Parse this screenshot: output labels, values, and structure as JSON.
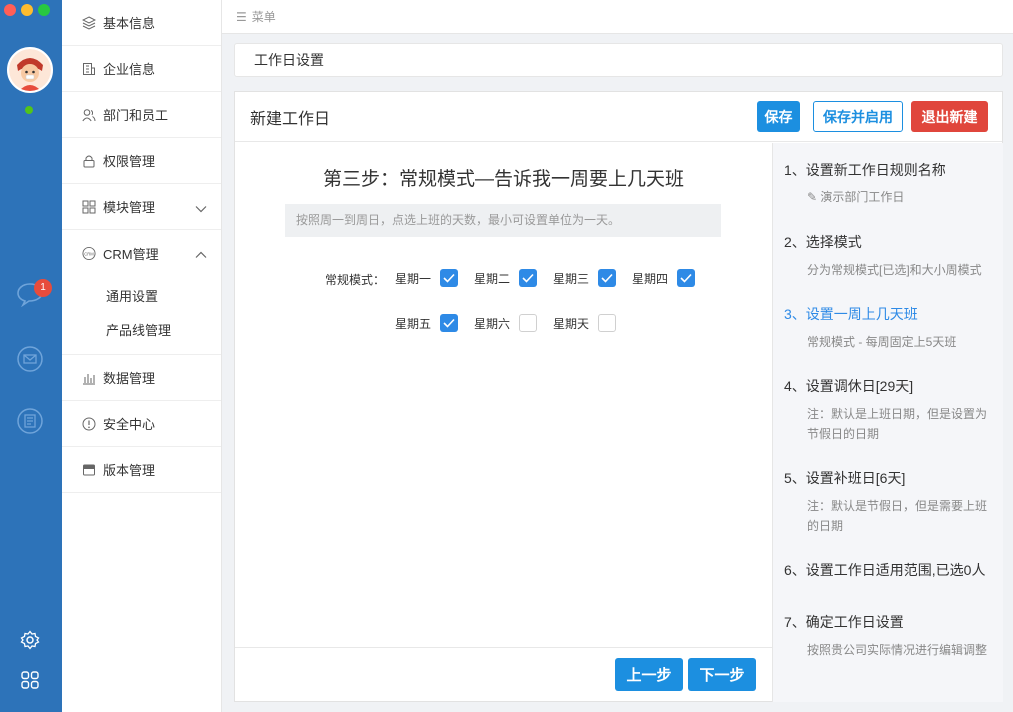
{
  "colors": {
    "rail": "#2d73b9",
    "primary": "#1c8fe0",
    "danger": "#e0463c",
    "checkbox": "#2e8ae6",
    "active_step": "#2e8ae6"
  },
  "window_controls": [
    {
      "name": "close",
      "color": "#ff5f57"
    },
    {
      "name": "minimize",
      "color": "#febc2e"
    },
    {
      "name": "zoom",
      "color": "#28c840"
    }
  ],
  "rail": {
    "message_badge": "1",
    "icons": [
      "chat-icon",
      "mail-icon",
      "notes-icon",
      "settings-icon",
      "apps-icon"
    ]
  },
  "menu": {
    "items": [
      {
        "label": "基本信息",
        "icon": "layers-icon"
      },
      {
        "label": "企业信息",
        "icon": "building-icon"
      },
      {
        "label": "部门和员工",
        "icon": "users-icon"
      },
      {
        "label": "权限管理",
        "icon": "lock-icon"
      },
      {
        "label": "模块管理",
        "icon": "grid-icon",
        "chevron": "down"
      },
      {
        "label": "CRM管理",
        "icon": "crm-icon",
        "chevron": "up"
      },
      {
        "label": "数据管理",
        "icon": "bar-chart-icon"
      },
      {
        "label": "安全中心",
        "icon": "alert-circle-icon"
      },
      {
        "label": "版本管理",
        "icon": "version-icon"
      }
    ],
    "crm_sub": [
      "通用设置",
      "产品线管理"
    ]
  },
  "topbar": {
    "menu_label": "菜单"
  },
  "page_title": "工作日设置",
  "card": {
    "title": "新建工作日",
    "save": "保存",
    "save_enable": "保存并启用",
    "exit": "退出新建"
  },
  "step": {
    "title": "第三步：常规模式—告诉我一周要上几天班",
    "hint": "按照周一到周日，点选上班的天数，最小可设置单位为一天。",
    "mode_label": "常规模式：",
    "days": [
      {
        "label": "星期一",
        "checked": true
      },
      {
        "label": "星期二",
        "checked": true
      },
      {
        "label": "星期三",
        "checked": true
      },
      {
        "label": "星期四",
        "checked": true
      },
      {
        "label": "星期五",
        "checked": true
      },
      {
        "label": "星期六",
        "checked": false
      },
      {
        "label": "星期天",
        "checked": false
      }
    ],
    "prev": "上一步",
    "next": "下一步"
  },
  "steps": [
    {
      "title": "1、设置新工作日规则名称",
      "desc": "演示部门工作日",
      "desc_icon": "pencil-icon"
    },
    {
      "title": "2、选择模式",
      "desc": "分为常规模式[已选]和大小周模式"
    },
    {
      "title": "3、设置一周上几天班",
      "desc": "常规模式 - 每周固定上5天班",
      "active": true
    },
    {
      "title": "4、设置调休日[29天]",
      "desc": "注：默认是上班日期，但是设置为节假日的日期"
    },
    {
      "title": "5、设置补班日[6天]",
      "desc": "注：默认是节假日，但是需要上班的日期"
    },
    {
      "title": "6、设置工作日适用范围,已选0人",
      "desc": ""
    },
    {
      "title": "7、确定工作日设置",
      "desc": "按照贵公司实际情况进行编辑调整"
    }
  ]
}
